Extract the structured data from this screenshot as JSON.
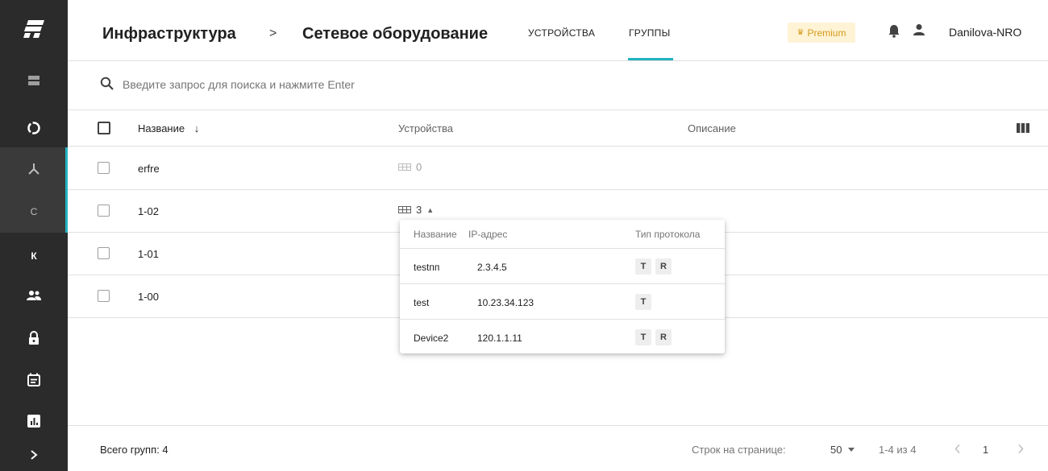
{
  "sidebar": {
    "logo": "app-logo",
    "items": [
      {
        "icon": "server-icon"
      },
      {
        "icon": "circle-icon"
      },
      {
        "icon": "network-icon"
      },
      {
        "letter": "C"
      },
      {
        "letter": "К"
      },
      {
        "icon": "users-icon"
      },
      {
        "icon": "lock-icon"
      },
      {
        "icon": "calendar-icon"
      },
      {
        "icon": "report-icon"
      },
      {
        "icon": "chevron-right-icon"
      }
    ]
  },
  "header": {
    "breadcrumb": [
      "Инфраструктура",
      "Сетевое оборудование"
    ],
    "separator": ">",
    "tabs": [
      {
        "label": "УСТРОЙСТВА"
      },
      {
        "label": "ГРУППЫ"
      }
    ],
    "premium_label": "Premium",
    "username": "Danilova-NRO"
  },
  "search": {
    "placeholder": "Введите запрос для поиска и нажмите Enter"
  },
  "table": {
    "columns": {
      "name": "Название",
      "sort_arrow": "↓",
      "devices": "Устройства",
      "description": "Описание"
    },
    "rows": [
      {
        "name": "erfre",
        "devices": "0"
      },
      {
        "name": "1-02",
        "devices": "3",
        "expanded": "▲"
      },
      {
        "name": "1-01"
      },
      {
        "name": "1-00"
      }
    ]
  },
  "popup": {
    "columns": {
      "name": "Название",
      "ip": "IP-адрес",
      "protocol": "Тип протокола"
    },
    "rows": [
      {
        "name": "testпп",
        "ip": "2.3.4.5",
        "protocols": [
          "T",
          "R"
        ]
      },
      {
        "name": "test",
        "ip": "10.23.34.123",
        "protocols": [
          "T"
        ]
      },
      {
        "name": "Device2",
        "ip": "120.1.1.11",
        "protocols": [
          "T",
          "R"
        ]
      }
    ]
  },
  "footer": {
    "total": "Всего групп: 4",
    "rows_per_page_label": "Строк на странице:",
    "rows_per_page": "50",
    "range": "1-4 из 4",
    "page": "1"
  },
  "colors": {
    "sidebar_bg": "#2b2b2b",
    "accent": "#22b3c0",
    "premium_bg": "#fff3d6",
    "premium_text": "#d39a1a"
  }
}
